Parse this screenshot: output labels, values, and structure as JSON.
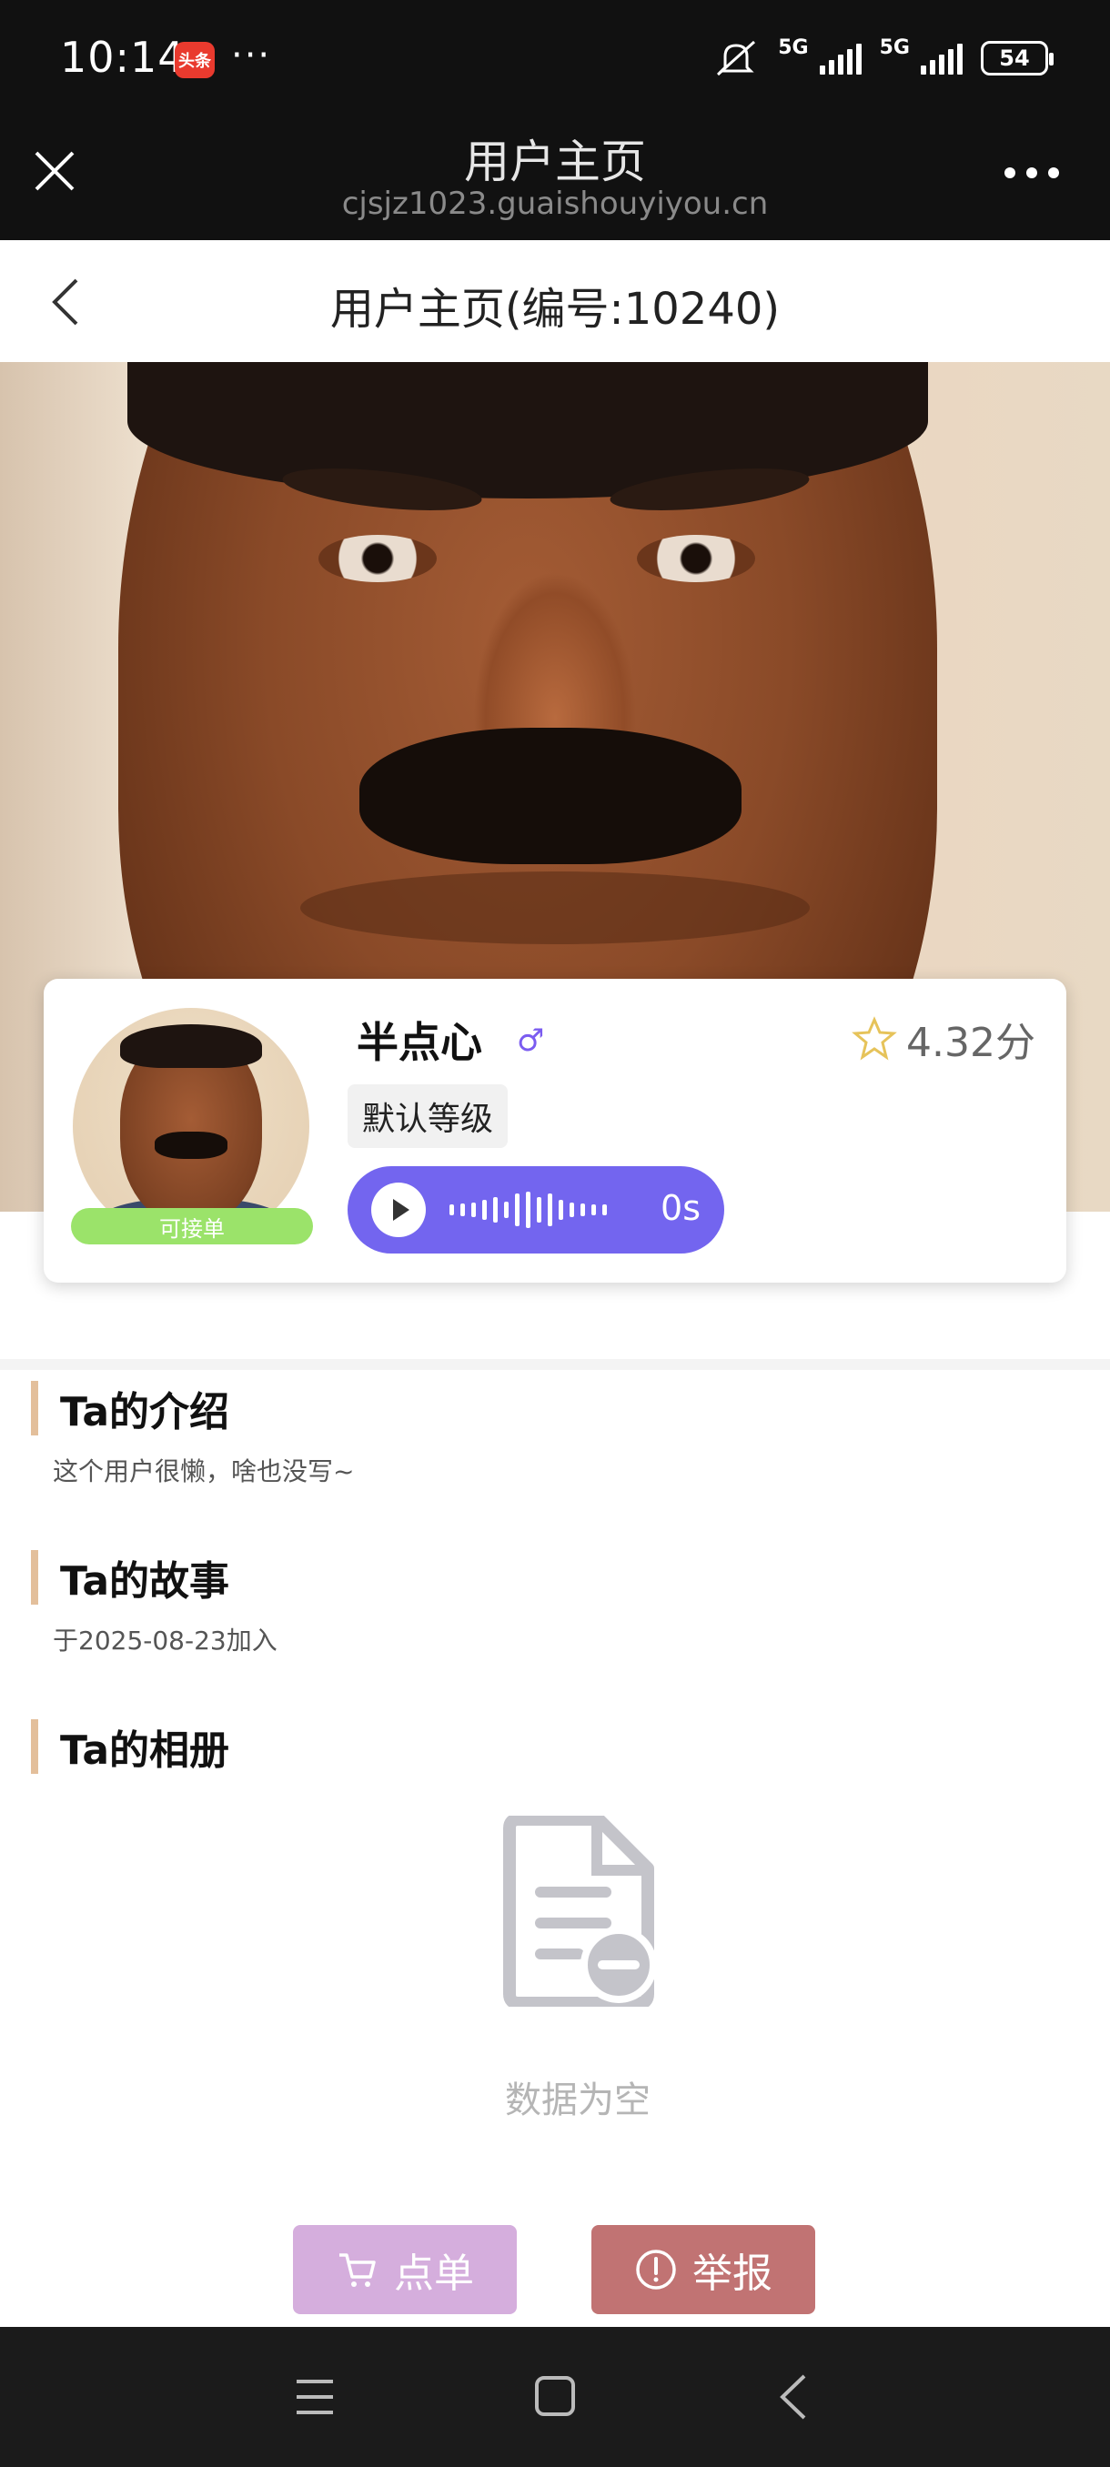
{
  "status_bar": {
    "time": "10:14",
    "app_badge": "头条",
    "more_dots": "···",
    "network_1": "5G",
    "network_2": "5G",
    "battery": "54"
  },
  "browser": {
    "title": "用户主页",
    "url": "cjsjz1023.guaishouyiyou.cn"
  },
  "page": {
    "title": "用户主页(编号:10240)"
  },
  "profile": {
    "name": "半点心",
    "gender_symbol": "♂",
    "rating": "4.32分",
    "level": "默认等级",
    "availability": "可接单",
    "voice_duration": "0s"
  },
  "sections": {
    "intro_title": "Ta的介绍",
    "intro_text": "这个用户很懒，啥也没写~",
    "story_title": "Ta的故事",
    "story_text": "于2025-08-23加入",
    "album_title": "Ta的相册",
    "empty_text": "数据为空"
  },
  "actions": {
    "order_label": "点单",
    "report_label": "举报"
  },
  "colors": {
    "accent_voice": "#7365ef",
    "available_green": "#9be36a",
    "section_bar": "#e3bf9b",
    "order_button": "#d5aedd",
    "report_button": "#c17373"
  },
  "icons": {
    "close": "close-icon",
    "more": "more-icon",
    "back": "back-icon",
    "star": "star-icon",
    "play": "play-icon",
    "cart": "cart-icon",
    "warning": "warning-icon",
    "empty": "empty-document-icon"
  }
}
